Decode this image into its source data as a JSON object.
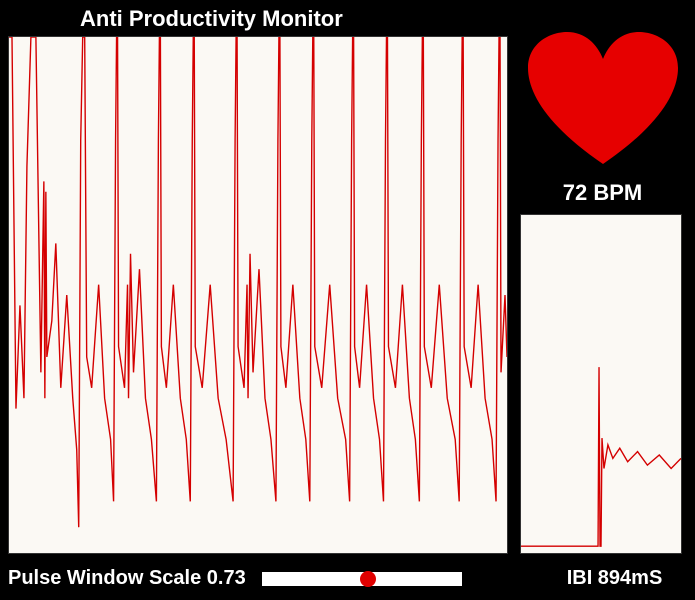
{
  "title": "Anti Productivity Monitor",
  "bpm_text": "72 BPM",
  "scale_label": "Pulse Window Scale 0.73",
  "ibi_label": "IBI 894mS",
  "scale_value": 0.53,
  "colors": {
    "trace": "#d40000",
    "heart": "#e60000",
    "panel_bg": "#fbf9f4"
  },
  "chart_data": [
    {
      "type": "line",
      "title": "Pulse waveform (main)",
      "xlabel": "",
      "ylabel": "",
      "ylim": [
        0,
        1
      ],
      "x": [
        0,
        3,
        7,
        11,
        15,
        18,
        22,
        27,
        32,
        35,
        36,
        37,
        38,
        43,
        47,
        52,
        58,
        64,
        68,
        70,
        72,
        74,
        76,
        78,
        83,
        90,
        96,
        102,
        105,
        107,
        108,
        109,
        110,
        116,
        119,
        120,
        122,
        125,
        131,
        137,
        143,
        148,
        150,
        151,
        152,
        153,
        158,
        165,
        172,
        178,
        182,
        184,
        185,
        186,
        187,
        194,
        202,
        210,
        218,
        225,
        227,
        228,
        229,
        230,
        236,
        239,
        240,
        242,
        245,
        251,
        257,
        263,
        268,
        270,
        271,
        272,
        273,
        278,
        285,
        292,
        298,
        302,
        304,
        305,
        306,
        307,
        314,
        322,
        330,
        338,
        342,
        344,
        345,
        346,
        347,
        352,
        359,
        366,
        372,
        376,
        378,
        379,
        380,
        381,
        388,
        395,
        402,
        408,
        412,
        414,
        415,
        416,
        417,
        424,
        432,
        440,
        448,
        452,
        454,
        455,
        456,
        457,
        464,
        471,
        478,
        485,
        489,
        491,
        492,
        493,
        494,
        498,
        500
      ],
      "y": [
        1,
        1,
        0.28,
        0.48,
        0.3,
        0.75,
        1,
        1,
        0.35,
        0.72,
        0.3,
        0.7,
        0.38,
        0.45,
        0.6,
        0.32,
        0.5,
        0.3,
        0.2,
        0.05,
        0.8,
        1,
        1,
        0.38,
        0.32,
        0.52,
        0.3,
        0.22,
        0.1,
        0.8,
        1,
        1,
        0.4,
        0.32,
        0.52,
        0.3,
        0.58,
        0.35,
        0.55,
        0.3,
        0.22,
        0.1,
        0.8,
        1,
        1,
        0.4,
        0.32,
        0.52,
        0.3,
        0.22,
        0.1,
        0.8,
        1,
        1,
        0.4,
        0.32,
        0.52,
        0.3,
        0.22,
        0.1,
        0.8,
        1,
        1,
        0.4,
        0.32,
        0.52,
        0.3,
        0.58,
        0.35,
        0.55,
        0.3,
        0.22,
        0.1,
        0.8,
        1,
        1,
        0.4,
        0.32,
        0.52,
        0.3,
        0.22,
        0.1,
        0.8,
        1,
        1,
        0.4,
        0.32,
        0.52,
        0.3,
        0.22,
        0.1,
        0.8,
        1,
        1,
        0.4,
        0.32,
        0.52,
        0.3,
        0.22,
        0.1,
        0.8,
        1,
        1,
        0.4,
        0.32,
        0.52,
        0.3,
        0.22,
        0.1,
        0.8,
        1,
        1,
        0.4,
        0.32,
        0.52,
        0.3,
        0.22,
        0.1,
        0.8,
        1,
        1,
        0.4,
        0.32,
        0.52,
        0.3,
        0.22,
        0.1,
        0.8,
        1,
        1,
        0.35,
        0.5,
        0.38
      ]
    },
    {
      "type": "line",
      "title": "IBI detail",
      "xlabel": "",
      "ylabel": "",
      "ylim": [
        0,
        1
      ],
      "x": [
        0,
        78,
        79,
        80,
        81,
        82,
        84,
        88,
        93,
        100,
        108,
        118,
        128,
        140,
        152,
        162
      ],
      "y": [
        0.02,
        0.02,
        0.55,
        0.02,
        0.02,
        0.34,
        0.25,
        0.32,
        0.28,
        0.31,
        0.27,
        0.3,
        0.26,
        0.29,
        0.25,
        0.28
      ]
    }
  ]
}
